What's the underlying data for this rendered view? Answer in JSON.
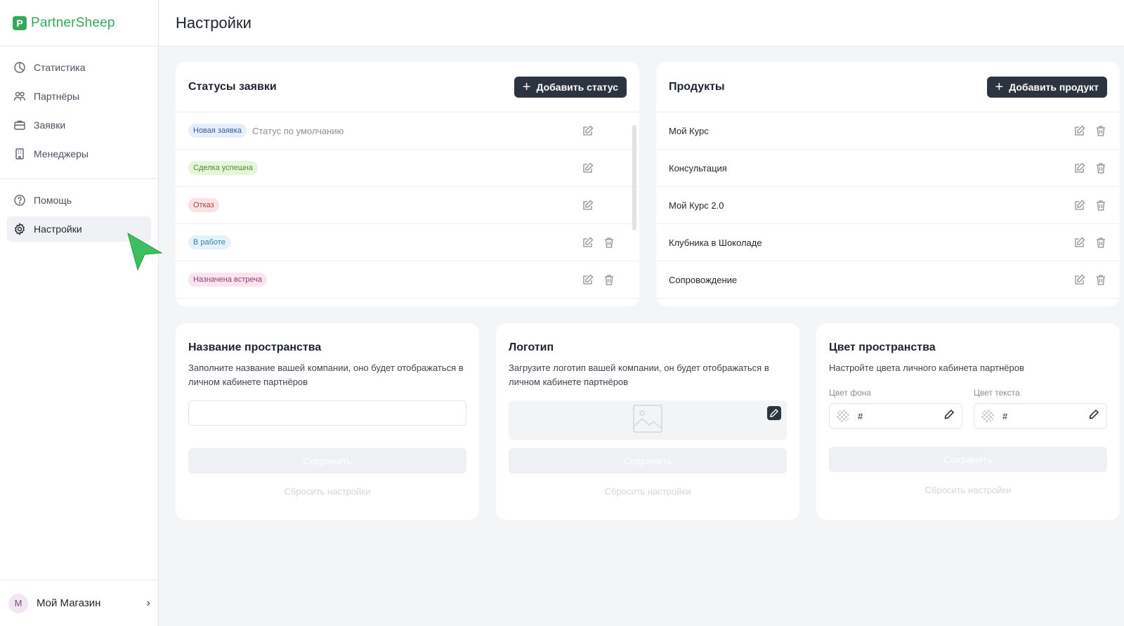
{
  "app": {
    "brand": "PartnerSheep",
    "brand_initial": "P"
  },
  "sidebar": {
    "main_items": [
      {
        "label": "Статистика",
        "icon": "chart-pie-icon"
      },
      {
        "label": "Партнёры",
        "icon": "users-icon"
      },
      {
        "label": "Заявки",
        "icon": "briefcase-icon"
      },
      {
        "label": "Менеджеры",
        "icon": "building-icon"
      }
    ],
    "secondary_items": [
      {
        "label": "Помощь",
        "icon": "help-icon"
      },
      {
        "label": "Настройки",
        "icon": "gear-icon",
        "active": true
      }
    ],
    "account": {
      "initial": "M",
      "name": "Мой Магазин"
    }
  },
  "header": {
    "title": "Настройки"
  },
  "statuses": {
    "title": "Статусы заявки",
    "add_label": "Добавить статус",
    "items": [
      {
        "label": "Новая заявка",
        "desc": "Статус по умолчанию",
        "bg": "#e6eefb",
        "color": "#3a5a99",
        "deletable": false
      },
      {
        "label": "Сделка успешна",
        "desc": "",
        "bg": "#e6f6dc",
        "color": "#4d8a2a",
        "deletable": false
      },
      {
        "label": "Отказ",
        "desc": "",
        "bg": "#fbe3e3",
        "color": "#b04242",
        "deletable": false
      },
      {
        "label": "В работе",
        "desc": "",
        "bg": "#e3f2fb",
        "color": "#3a7ea8",
        "deletable": true
      },
      {
        "label": "Назначена встреча",
        "desc": "",
        "bg": "#fbe4ef",
        "color": "#9a3b6a",
        "deletable": true
      }
    ]
  },
  "products": {
    "title": "Продукты",
    "add_label": "Добавить продукт",
    "items": [
      "Мой Курс",
      "Консультация",
      "Мой Курс 2.0",
      "Клубника в Шоколаде",
      "Сопровождение"
    ]
  },
  "space_name": {
    "title": "Название пространства",
    "desc": "Заполните название вашей компании, оно будет отображаться в личном кабинете партнёров",
    "input_value": "",
    "save_label": "Сохранить",
    "reset_label": "Сбросить настройки"
  },
  "logo_card": {
    "title": "Логотип",
    "desc": "Загрузите логотип вашей компании, он будет отображаться в личном кабинете партнёров",
    "save_label": "Сохранить",
    "reset_label": "Сбросить настройки"
  },
  "space_color": {
    "title": "Цвет пространства",
    "desc": "Настройте цвета личного кабинета партнёров",
    "bg_label": "Цвет фона",
    "text_label": "Цвет текста",
    "bg_value": "#",
    "text_value": "#",
    "save_label": "Сохранить",
    "reset_label": "Сбросить настройки"
  },
  "colors": {
    "brand": "#34a85a",
    "button_dark": "#2c3440",
    "cursor": "#3cbf5e"
  }
}
